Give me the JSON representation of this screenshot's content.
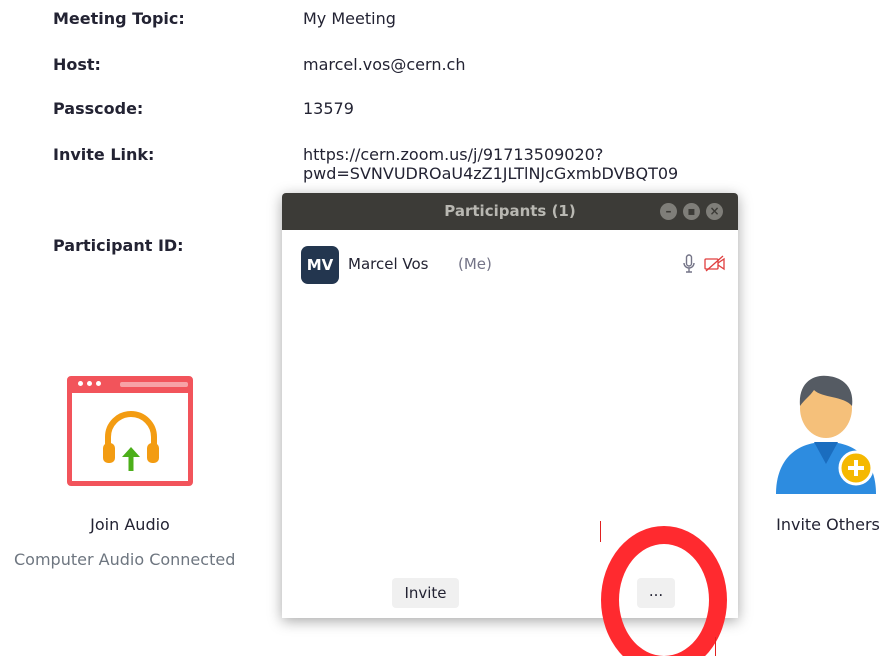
{
  "meeting_info": {
    "topic_label": "Meeting Topic:",
    "topic_value": "My Meeting",
    "host_label": "Host:",
    "host_value": "marcel.vos@cern.ch",
    "passcode_label": "Passcode:",
    "passcode_value": "13579",
    "invite_link_label": "Invite Link:",
    "invite_link_line1": "https://cern.zoom.us/j/91713509020?",
    "invite_link_line2": "pwd=SVNVUDROaU4zZ1JLTlNJcGxmbDVBQT09",
    "participant_id_label": "Participant ID:"
  },
  "join_audio": {
    "label": "Join Audio",
    "status": "Computer Audio Connected",
    "icon": "headphones-upload-icon"
  },
  "invite_others": {
    "label": "Invite Others",
    "icon": "person-add-icon"
  },
  "participants_panel": {
    "title": "Participants (1)",
    "participants": [
      {
        "initials": "MV",
        "name": "Marcel Vos",
        "tag": "(Me)",
        "mic_icon": "microphone-icon",
        "video_icon": "video-off-icon"
      }
    ],
    "invite_button": "Invite",
    "more_button": "..."
  },
  "colors": {
    "accent_red": "#f2545b",
    "annotation_red": "#ff2a2f",
    "avatar_bg": "#23364f",
    "titlebar_bg": "#3c3b37",
    "invite_blue": "#2d8ce0"
  }
}
